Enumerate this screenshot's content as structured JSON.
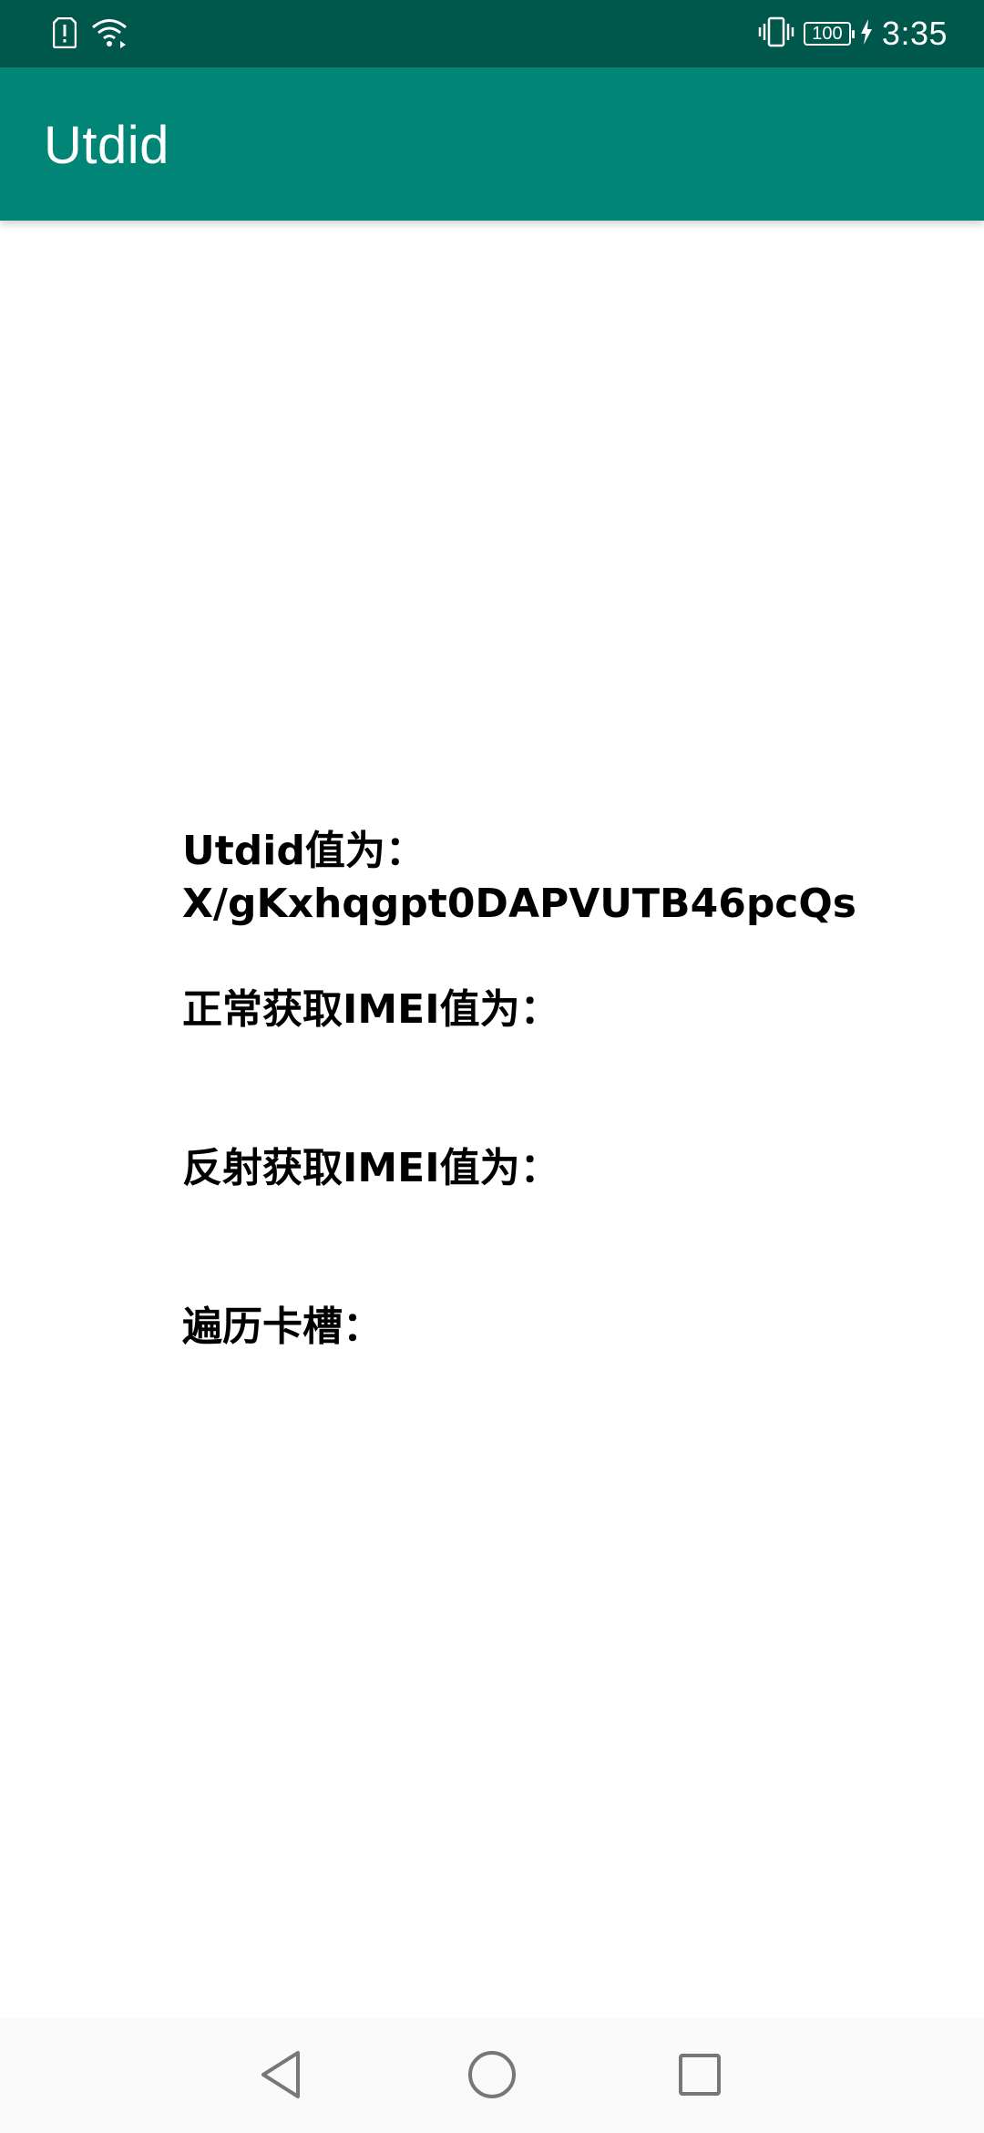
{
  "status_bar": {
    "time": "3:35",
    "battery_level": "100",
    "icons": [
      "sim-alert-icon",
      "wifi-icon",
      "vibrate-icon",
      "battery-icon",
      "charging-icon"
    ]
  },
  "app_bar": {
    "title": "Utdid"
  },
  "content": {
    "utdid_label": "Utdid值为：",
    "utdid_value": "X/gKxhqgpt0DAPVUTB46pcQs",
    "imei_normal_label": "正常获取IMEI值为：",
    "imei_normal_value": "",
    "imei_reflect_label": "反射获取IMEI值为：",
    "imei_reflect_value": "",
    "slot_label": "遍历卡槽："
  },
  "nav_bar": {
    "buttons": [
      "back-icon",
      "home-icon",
      "recents-icon"
    ]
  },
  "colors": {
    "status_bar": "#00574b",
    "app_bar": "#008577",
    "text": "#000000",
    "nav_bar": "#fafafa",
    "nav_icon": "#777777"
  }
}
